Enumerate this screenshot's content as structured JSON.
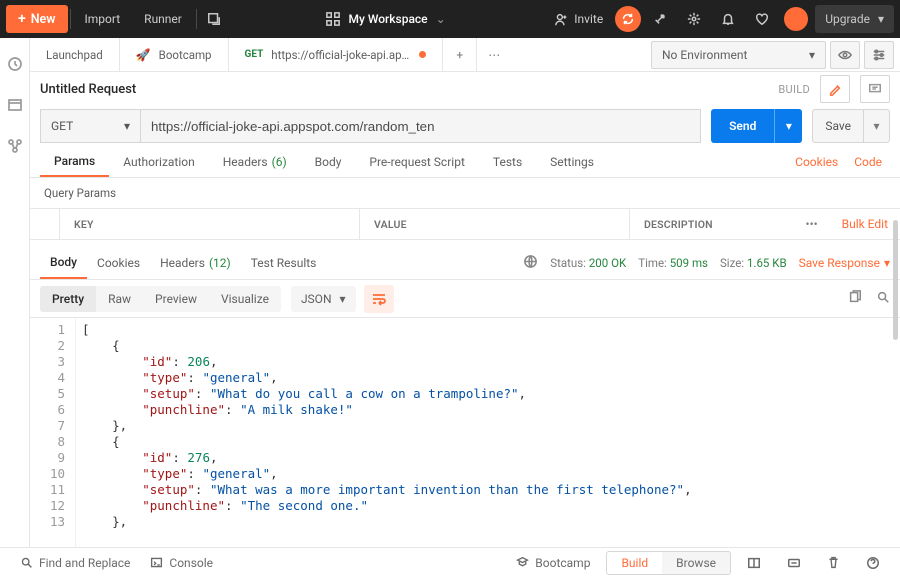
{
  "topbar": {
    "new": "New",
    "import": "Import",
    "runner": "Runner",
    "workspace": "My Workspace",
    "invite": "Invite",
    "upgrade": "Upgrade"
  },
  "tabs": {
    "t1": "Launchpad",
    "t2": "Bootcamp",
    "t3_method": "GET",
    "t3_url": "https://official-joke-api.app...",
    "env": "No Environment"
  },
  "title": "Untitled Request",
  "titlerow": {
    "build": "BUILD"
  },
  "request": {
    "method": "GET",
    "url": "https://official-joke-api.appspot.com/random_ten",
    "send": "Send",
    "save": "Save"
  },
  "reqtabs": {
    "params": "Params",
    "auth": "Authorization",
    "headers": "Headers",
    "headers_n": "(6)",
    "body": "Body",
    "prs": "Pre-request Script",
    "tests": "Tests",
    "settings": "Settings",
    "cookies": "Cookies",
    "code": "Code"
  },
  "qp": {
    "title": "Query Params",
    "key": "KEY",
    "value": "VALUE",
    "desc": "DESCRIPTION",
    "bulk": "Bulk Edit"
  },
  "resptabs": {
    "body": "Body",
    "cookies": "Cookies",
    "headers": "Headers",
    "headers_n": "(12)",
    "tr": "Test Results",
    "status_lbl": "Status:",
    "status": "200 OK",
    "time_lbl": "Time:",
    "time": "509 ms",
    "size_lbl": "Size:",
    "size": "1.65 KB",
    "save": "Save Response"
  },
  "viewer": {
    "pretty": "Pretty",
    "raw": "Raw",
    "preview": "Preview",
    "visualize": "Visualize",
    "format": "JSON"
  },
  "json_lines": [
    {
      "ind": 0,
      "type": "brace",
      "text": "["
    },
    {
      "ind": 1,
      "type": "brace",
      "text": "{"
    },
    {
      "ind": 2,
      "type": "kv",
      "key": "id",
      "val": "206",
      "num": true,
      "comma": true
    },
    {
      "ind": 2,
      "type": "kv",
      "key": "type",
      "val": "\"general\"",
      "comma": true
    },
    {
      "ind": 2,
      "type": "kv",
      "key": "setup",
      "val": "\"What do you call a cow on a trampoline?\"",
      "comma": true
    },
    {
      "ind": 2,
      "type": "kv",
      "key": "punchline",
      "val": "\"A milk shake!\""
    },
    {
      "ind": 1,
      "type": "brace",
      "text": "},"
    },
    {
      "ind": 1,
      "type": "brace",
      "text": "{"
    },
    {
      "ind": 2,
      "type": "kv",
      "key": "id",
      "val": "276",
      "num": true,
      "comma": true
    },
    {
      "ind": 2,
      "type": "kv",
      "key": "type",
      "val": "\"general\"",
      "comma": true
    },
    {
      "ind": 2,
      "type": "kv",
      "key": "setup",
      "val": "\"What was a more important invention than the first telephone?\"",
      "comma": true
    },
    {
      "ind": 2,
      "type": "kv",
      "key": "punchline",
      "val": "\"The second one.\""
    },
    {
      "ind": 1,
      "type": "brace",
      "text": "},"
    }
  ],
  "footer": {
    "find": "Find and Replace",
    "console": "Console",
    "bootcamp": "Bootcamp",
    "build": "Build",
    "browse": "Browse"
  }
}
